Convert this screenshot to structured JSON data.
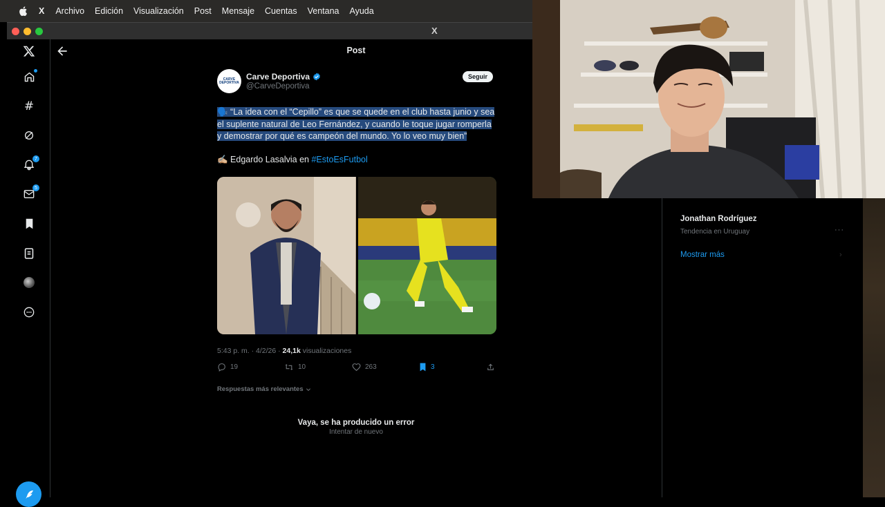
{
  "menubar": {
    "app": "X",
    "items": [
      "Archivo",
      "Edición",
      "Visualización",
      "Post",
      "Mensaje",
      "Cuentas",
      "Ventana",
      "Ayuda"
    ]
  },
  "window": {
    "title_x": "X"
  },
  "nav": {
    "icons": [
      "x-logo-icon",
      "home-icon",
      "explore-icon",
      "grok-icon",
      "notifications-icon",
      "messages-icon",
      "bookmarks-icon",
      "lists-icon",
      "profile-icon",
      "more-icon"
    ],
    "notifications_badge": "7",
    "messages_badge": "5"
  },
  "header": {
    "title": "Post"
  },
  "tweet": {
    "name": "Carve Deportiva",
    "handle": "@CarveDeportiva",
    "avatar_text": "CARVE DEPORTIVA",
    "follow_label": "Seguir",
    "text_line1": "🗣️ “La idea con el “Cepillo” es que se quede en el club hasta junio y sea",
    "text_line2": "el suplente natural de Leo Fernández, y cuando le toque jugar romperla",
    "text_line3": "y demostrar por qué es campeón del mundo. Yo lo veo muy bien”",
    "author_prefix": "✍🏼 Edgardo Lasalvia en ",
    "hashtag": "#EstoEsFutbol",
    "time": "5:43 p. m. · 4/2/26 · ",
    "views": "24,1k",
    "views_label": " visualizaciones",
    "replies": "19",
    "reposts": "10",
    "likes": "263",
    "bookmarks": "3"
  },
  "replies_sort": "Respuestas más relevantes",
  "error": {
    "title": "Vaya, se ha producido un error",
    "retry": "Intentar de nuevo"
  },
  "sidebar": {
    "trend_name": "Jonathan Rodríguez",
    "trend_sub": "Tendencia en Uruguay",
    "trend_more": "···",
    "show_more": "Mostrar más"
  },
  "colors": {
    "accent": "#1d9bf0",
    "bg": "#000000",
    "border": "#2f3336",
    "highlight": "#264a7d"
  }
}
